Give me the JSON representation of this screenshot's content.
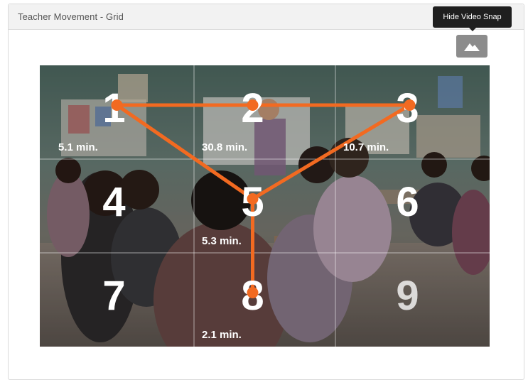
{
  "panel": {
    "title": "Teacher Movement - Grid"
  },
  "tooltip": {
    "text": "Hide Video Snap"
  },
  "snap_button": {
    "icon": "mountain-image-icon"
  },
  "colors": {
    "path": "#f26a21",
    "header_bg": "#f2f2f2",
    "tooltip_bg": "#1f1f1f",
    "button_bg": "#8c8c8c"
  },
  "grid": {
    "cells": [
      {
        "number": "1",
        "time": "5.1 min."
      },
      {
        "number": "2",
        "time": "30.8 min."
      },
      {
        "number": "3",
        "time": "10.7 min."
      },
      {
        "number": "4",
        "time": ""
      },
      {
        "number": "5",
        "time": "5.3 min."
      },
      {
        "number": "6",
        "time": ""
      },
      {
        "number": "7",
        "time": ""
      },
      {
        "number": "8",
        "time": "2.1 min."
      },
      {
        "number": "9",
        "time": ""
      }
    ],
    "path_sequence": [
      1,
      2,
      3,
      5,
      1,
      5,
      8
    ]
  }
}
